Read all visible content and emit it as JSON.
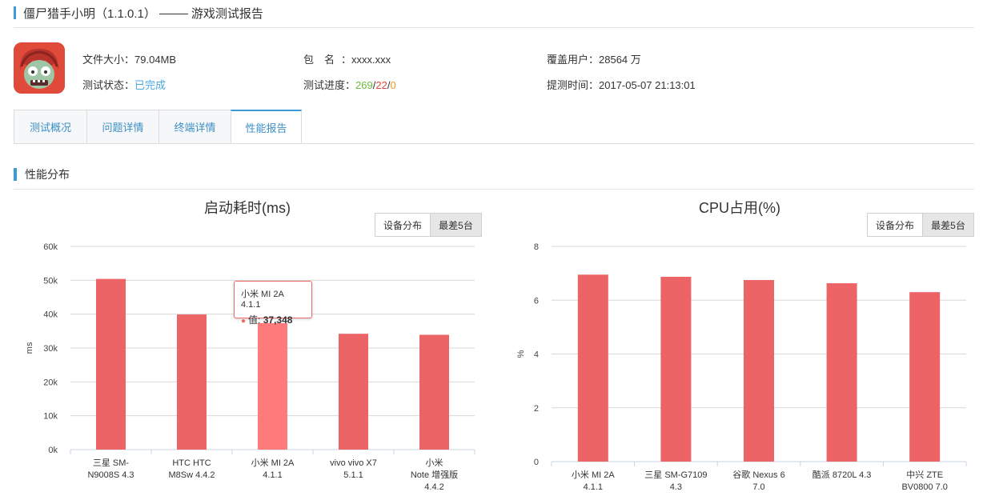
{
  "header": {
    "title_part1": "僵尸猎手小明（1.1.0.1）",
    "title_part2": "游戏测试报告"
  },
  "app_info": {
    "file_size_label": "文件大小：",
    "file_size": "79.04MB",
    "package_label": "包　名",
    "package_sep": "：",
    "package_name": "xxxx.xxx",
    "users_label": "覆盖用户：",
    "users": "28564 万",
    "status_label": "测试状态：",
    "status": "已完成",
    "progress_label": "测试进度：",
    "progress_pass": "269",
    "progress_fail": "22",
    "progress_other": "0",
    "progress_sep": "/",
    "submit_time_label": "提测时间：",
    "submit_time": "2017-05-07 21:13:01"
  },
  "tabs": [
    {
      "label": "测试概况",
      "active": false
    },
    {
      "label": "问题详情",
      "active": false
    },
    {
      "label": "终端详情",
      "active": false
    },
    {
      "label": "性能报告",
      "active": true
    }
  ],
  "section_title": "性能分布",
  "toggle": {
    "device_distribution": "设备分布",
    "worst_five": "最差5台"
  },
  "colors": {
    "bar": "#ec6466",
    "bar_highlight": "#ff7a7a",
    "accent": "#3c9bd6"
  },
  "tooltip": {
    "title": "小米 MI 2A 4.1.1",
    "value_label": "值:",
    "value": "37,348"
  },
  "chart_data": [
    {
      "type": "bar",
      "title": "启动耗时(ms)",
      "ylabel": "ms",
      "ylim": [
        0,
        60000
      ],
      "y_ticks": [
        0,
        10000,
        20000,
        30000,
        40000,
        50000,
        60000
      ],
      "y_tick_labels": [
        "0k",
        "10k",
        "20k",
        "30k",
        "40k",
        "50k",
        "60k"
      ],
      "grid": true,
      "categories": [
        [
          "三星 SM-",
          "N9008S 4.3"
        ],
        [
          "HTC HTC",
          "M8Sw 4.4.2"
        ],
        [
          "小米 MI 2A",
          "4.1.1"
        ],
        [
          "vivo vivo X7",
          "5.1.1"
        ],
        [
          "小米",
          "Note 增强版",
          "4.4.2"
        ]
      ],
      "values": [
        50400,
        39900,
        37348,
        34200,
        33900
      ],
      "highlighted_index": 2
    },
    {
      "type": "bar",
      "title": "CPU占用(%)",
      "ylabel": "%",
      "ylim": [
        0,
        8
      ],
      "y_ticks": [
        0,
        2,
        4,
        6,
        8
      ],
      "y_tick_labels": [
        "0",
        "2",
        "4",
        "6",
        "8"
      ],
      "grid": true,
      "categories": [
        [
          "小米 MI 2A",
          "4.1.1"
        ],
        [
          "三星 SM-G7109",
          "4.3"
        ],
        [
          "谷歌 Nexus 6",
          "7.0"
        ],
        [
          "酷派 8720L 4.3"
        ],
        [
          "中兴 ZTE",
          "BV0800 7.0"
        ]
      ],
      "values": [
        6.95,
        6.87,
        6.75,
        6.63,
        6.3
      ],
      "highlighted_index": -1
    }
  ]
}
